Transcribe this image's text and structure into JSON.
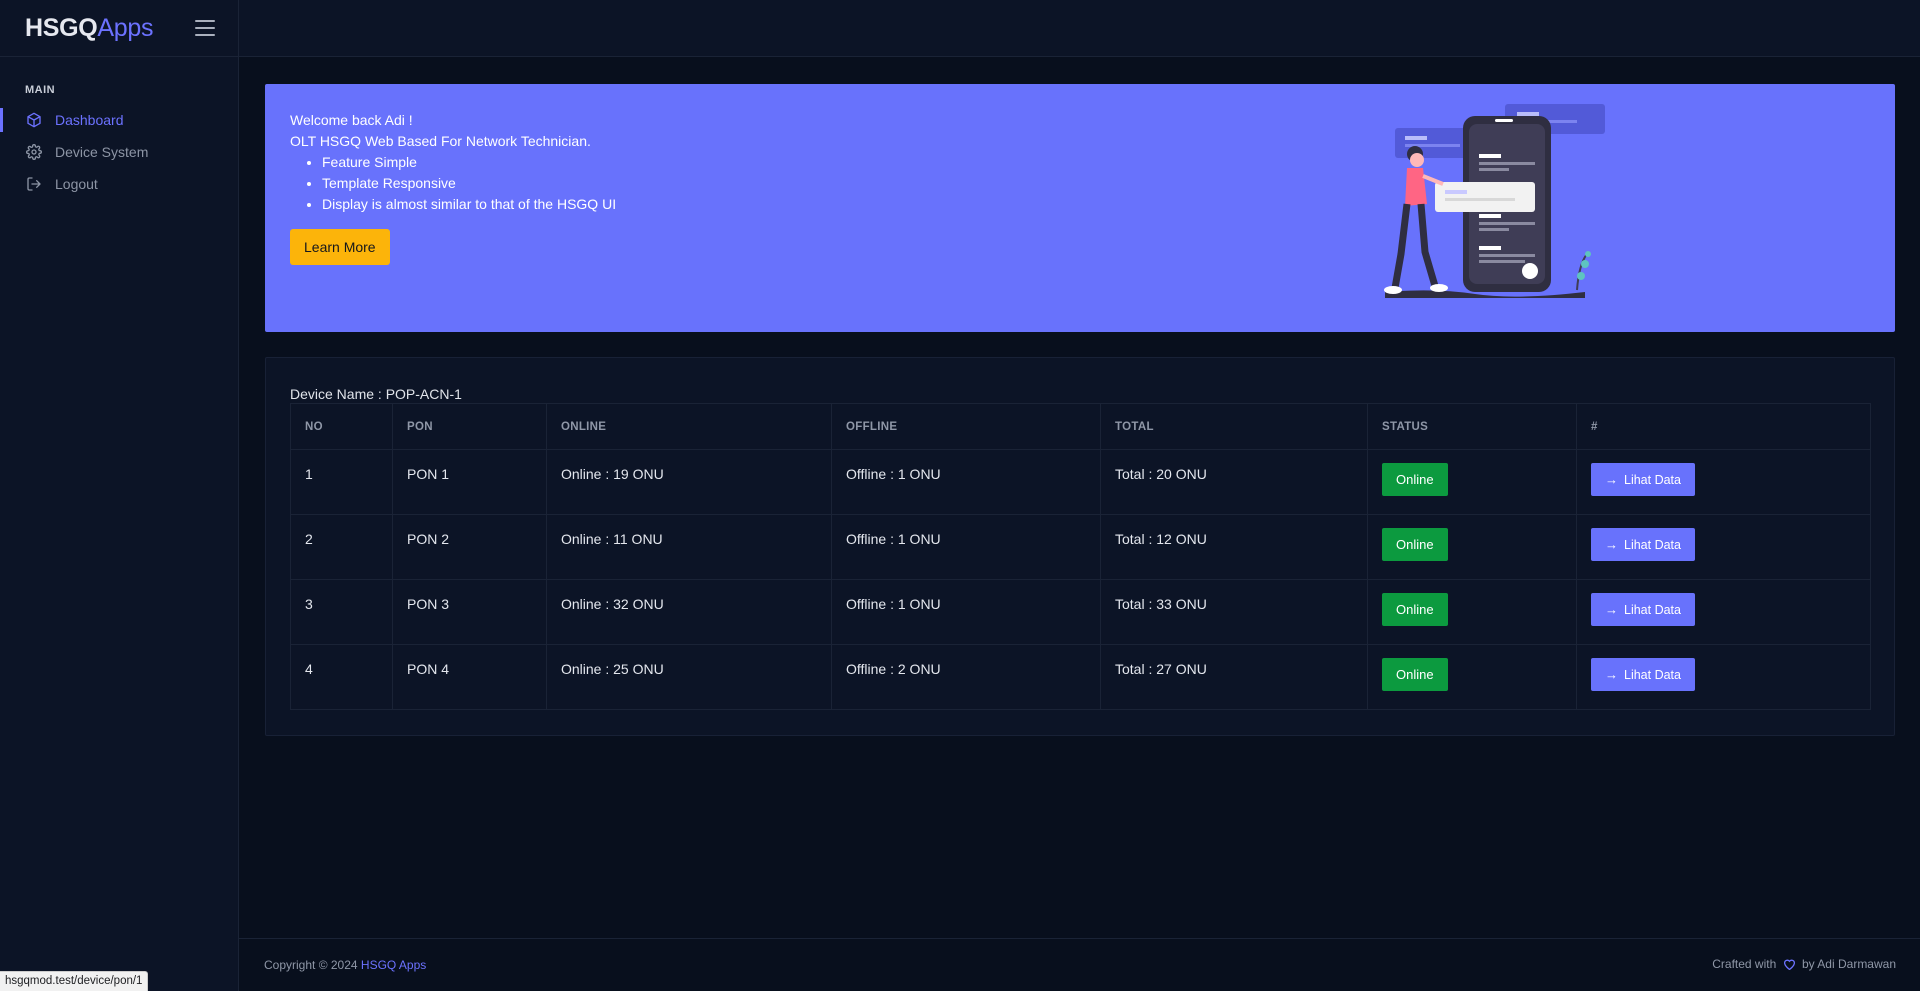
{
  "brand": {
    "bold": "HSGQ",
    "light": "Apps"
  },
  "sidebar": {
    "heading": "MAIN",
    "items": [
      {
        "label": "Dashboard",
        "icon": "cube-icon",
        "active": true
      },
      {
        "label": "Device System",
        "icon": "gear-icon",
        "active": false
      },
      {
        "label": "Logout",
        "icon": "logout-icon",
        "active": false
      }
    ]
  },
  "banner": {
    "greeting": "Welcome back Adi !",
    "subtitle": "OLT HSGQ Web Based For Network Technician.",
    "features": [
      "Feature Simple",
      "Template Responsive",
      "Display is almost similar to that of the HSGQ UI"
    ],
    "button_label": "Learn More"
  },
  "device": {
    "label": "Device Name : POP-ACN-1",
    "columns": [
      "NO",
      "PON",
      "ONLINE",
      "OFFLINE",
      "TOTAL",
      "STATUS",
      "#"
    ],
    "rows": [
      {
        "no": "1",
        "pon": "PON 1",
        "online": "Online : 19 ONU",
        "offline": "Offline : 1 ONU",
        "total": "Total : 20 ONU",
        "status": "Online",
        "action": "Lihat Data"
      },
      {
        "no": "2",
        "pon": "PON 2",
        "online": "Online : 11 ONU",
        "offline": "Offline : 1 ONU",
        "total": "Total : 12 ONU",
        "status": "Online",
        "action": "Lihat Data"
      },
      {
        "no": "3",
        "pon": "PON 3",
        "online": "Online : 32 ONU",
        "offline": "Offline : 1 ONU",
        "total": "Total : 33 ONU",
        "status": "Online",
        "action": "Lihat Data"
      },
      {
        "no": "4",
        "pon": "PON 4",
        "online": "Online : 25 ONU",
        "offline": "Offline : 2 ONU",
        "total": "Total : 27 ONU",
        "status": "Online",
        "action": "Lihat Data"
      }
    ]
  },
  "footer": {
    "copyright": "Copyright © 2024",
    "link": "HSGQ Apps",
    "crafted_prefix": "Crafted with",
    "crafted_suffix": "by Adi Darmawan"
  },
  "status_url": "hsgqmod.test/device/pon/1",
  "colors": {
    "accent": "#6872fc",
    "success": "#0c9a3f",
    "warning": "#fcb40a",
    "background": "#080f1d"
  }
}
